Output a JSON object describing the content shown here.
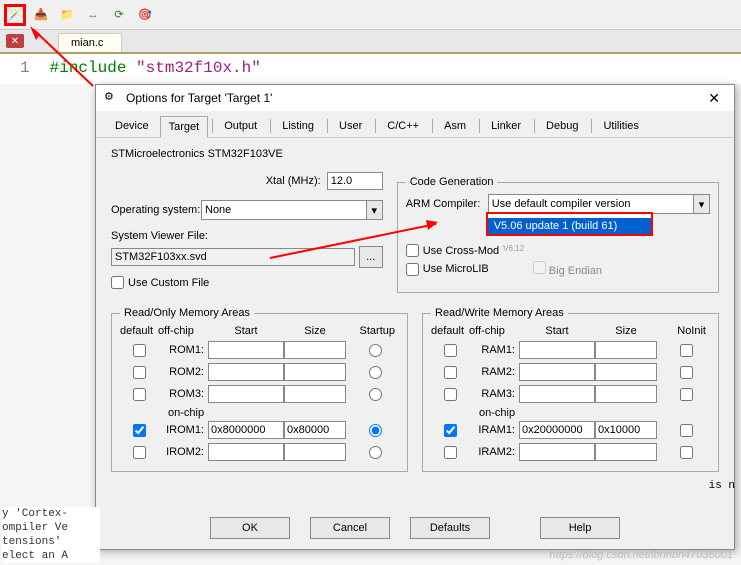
{
  "toolbar": {
    "icons": [
      "wand-icon",
      "download-icon",
      "folder-icon",
      "build-icon",
      "rebuild-icon",
      "target-icon"
    ]
  },
  "editor": {
    "file_tab": "mian.c",
    "line_number": "1",
    "code_pp": "#include ",
    "code_str": "\"stm32f10x.h\""
  },
  "dialog": {
    "title": "Options for Target 'Target 1'",
    "tabs": [
      "Device",
      "Target",
      "Output",
      "Listing",
      "User",
      "C/C++",
      "Asm",
      "Linker",
      "Debug",
      "Utilities"
    ],
    "active_tab": "Target",
    "device_name": "STMicroelectronics STM32F103VE",
    "xtal_label": "Xtal (MHz):",
    "xtal_value": "12.0",
    "os_label": "Operating system:",
    "os_value": "None",
    "svf_label": "System Viewer File:",
    "svf_value": "STM32F103xx.svd",
    "use_custom_file": "Use Custom File",
    "codegen": {
      "legend": "Code Generation",
      "arm_compiler_label": "ARM Compiler:",
      "arm_compiler_value": "Use default compiler version",
      "dropdown_options": [
        "Use default compiler version",
        "V5.06 update 1 (build 61)",
        "V6.12"
      ],
      "use_cross": "Use Cross-Mod",
      "use_microlib": "Use MicroLIB",
      "big_endian": "Big Endian"
    },
    "mem_ro": {
      "legend": "Read/Only Memory Areas",
      "headers": [
        "default",
        "off-chip",
        "",
        "Start",
        "Size",
        "Startup"
      ],
      "rows": [
        {
          "label": "ROM1:",
          "start": "",
          "size": "",
          "mode": "radio",
          "checked": false,
          "defchk": false
        },
        {
          "label": "ROM2:",
          "start": "",
          "size": "",
          "mode": "radio",
          "checked": false,
          "defchk": false
        },
        {
          "label": "ROM3:",
          "start": "",
          "size": "",
          "mode": "radio",
          "checked": false,
          "defchk": false
        }
      ],
      "onchip_label": "on-chip",
      "rows2": [
        {
          "label": "IROM1:",
          "start": "0x8000000",
          "size": "0x80000",
          "mode": "radio",
          "checked": true,
          "defchk": true
        },
        {
          "label": "IROM2:",
          "start": "",
          "size": "",
          "mode": "radio",
          "checked": false,
          "defchk": false
        }
      ]
    },
    "mem_rw": {
      "legend": "Read/Write Memory Areas",
      "headers": [
        "default",
        "off-chip",
        "",
        "Start",
        "Size",
        "NoInit"
      ],
      "rows": [
        {
          "label": "RAM1:",
          "start": "",
          "size": "",
          "defchk": false,
          "noinit": false
        },
        {
          "label": "RAM2:",
          "start": "",
          "size": "",
          "defchk": false,
          "noinit": false
        },
        {
          "label": "RAM3:",
          "start": "",
          "size": "",
          "defchk": false,
          "noinit": false
        }
      ],
      "onchip_label": "on-chip",
      "rows2": [
        {
          "label": "IRAM1:",
          "start": "0x20000000",
          "size": "0x10000",
          "defchk": true,
          "noinit": false
        },
        {
          "label": "IRAM2:",
          "start": "",
          "size": "",
          "defchk": false,
          "noinit": false
        }
      ]
    },
    "buttons": {
      "ok": "OK",
      "cancel": "Cancel",
      "defaults": "Defaults",
      "help": "Help"
    }
  },
  "output_lines": [
    "y 'Cortex-",
    "ompiler Ve",
    "tensions'",
    "elect an A"
  ],
  "right_snippet": "is n",
  "watermark": "https://blog.csdn.net/lbnnbn47036001"
}
